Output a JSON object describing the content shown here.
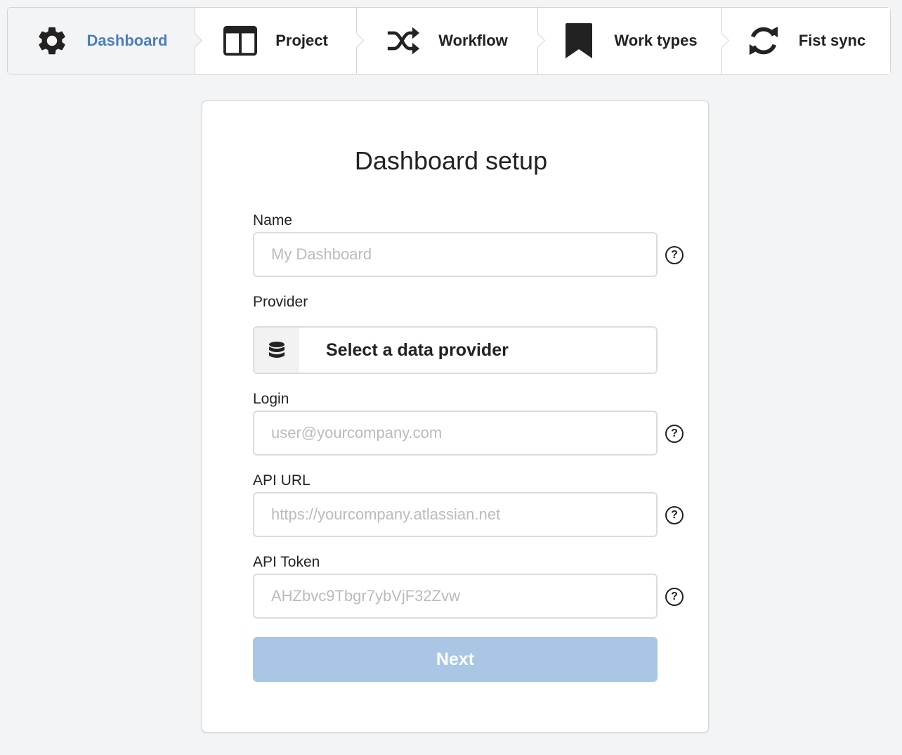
{
  "steps": [
    {
      "label": "Dashboard",
      "icon": "gear-icon",
      "active": true
    },
    {
      "label": "Project",
      "icon": "columns-icon",
      "active": false
    },
    {
      "label": "Workflow",
      "icon": "shuffle-icon",
      "active": false
    },
    {
      "label": "Work types",
      "icon": "bookmark-icon",
      "active": false
    },
    {
      "label": "Fist sync",
      "icon": "sync-icon",
      "active": false
    }
  ],
  "form": {
    "title": "Dashboard setup",
    "name": {
      "label": "Name",
      "placeholder": "My Dashboard",
      "value": ""
    },
    "provider": {
      "label": "Provider",
      "button_label": "Select a data provider",
      "icon": "database-icon"
    },
    "login": {
      "label": "Login",
      "placeholder": "user@yourcompany.com",
      "value": ""
    },
    "api_url": {
      "label": "API URL",
      "placeholder": "https://yourcompany.atlassian.net",
      "value": ""
    },
    "api_token": {
      "label": "API Token",
      "placeholder": "AHZbvc9Tbgr7ybVjF32Zvw",
      "value": ""
    },
    "help_glyph": "?",
    "next_label": "Next"
  },
  "colors": {
    "accent": "#4a7fbd",
    "button_disabled": "#a9c6e5",
    "page_background": "#f3f4f5"
  }
}
